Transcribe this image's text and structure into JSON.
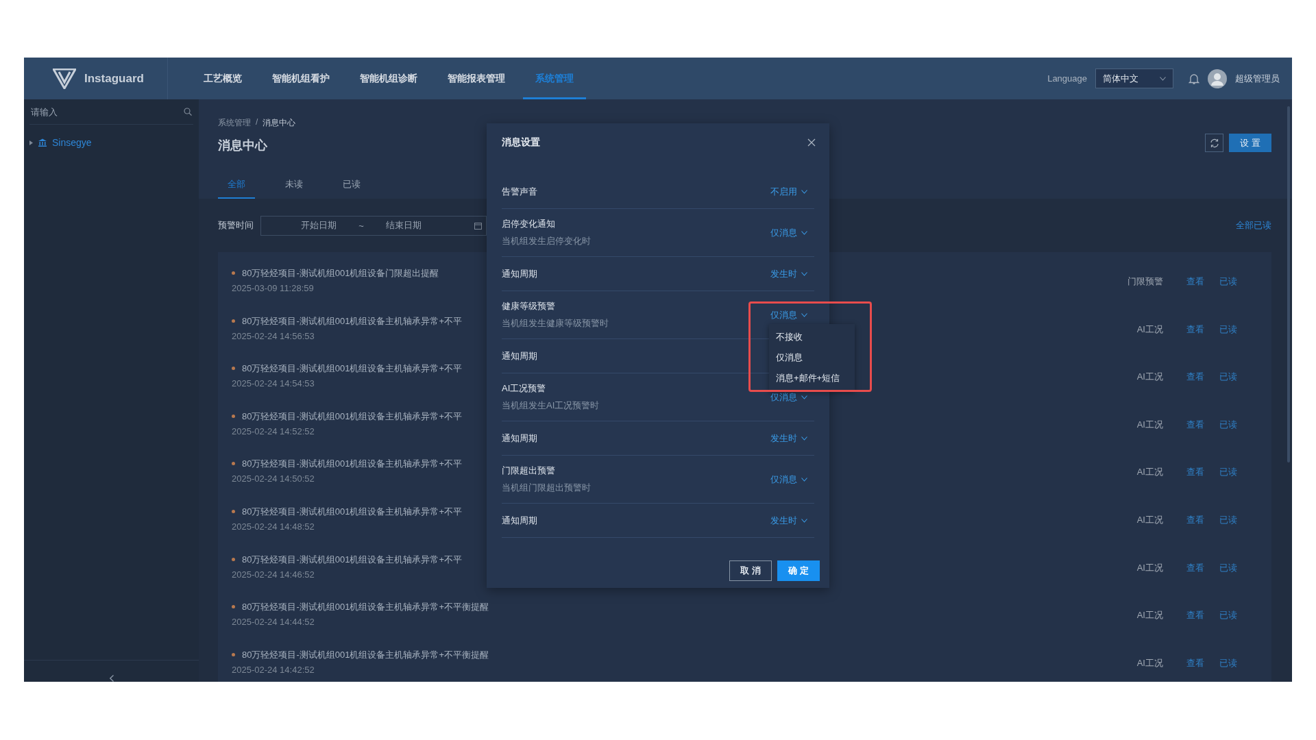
{
  "header": {
    "logo_text": "Instaguard",
    "nav": [
      {
        "label": "工艺概览",
        "selected": false
      },
      {
        "label": "智能机组看护",
        "selected": false
      },
      {
        "label": "智能机组诊断",
        "selected": false
      },
      {
        "label": "智能报表管理",
        "selected": false
      },
      {
        "label": "系统管理",
        "selected": true
      }
    ],
    "language_label": "Language",
    "language_value": "简体中文",
    "user_name": "超级管理员"
  },
  "sidebar": {
    "search_placeholder": "请输入",
    "tree": [
      {
        "label": "Sinsegye",
        "expanded": false
      }
    ]
  },
  "content": {
    "breadcrumb": [
      "系统管理",
      "/",
      "消息中心"
    ],
    "title": "消息中心",
    "refresh": true,
    "settings_button": "设 置",
    "tabs": [
      {
        "label": "全部",
        "selected": true
      },
      {
        "label": "未读",
        "selected": false
      },
      {
        "label": "已读",
        "selected": false
      }
    ],
    "filter": {
      "label": "预警时间",
      "start_placeholder": "开始日期",
      "separator": "~",
      "end_placeholder": "结束日期"
    },
    "mark_all_read": "全部已读",
    "messages": [
      {
        "title": "80万轻烃项目-测试机组001机组设备门限超出提醒",
        "time": "2025-03-09 11:28:59",
        "type": "门限预警",
        "actions": [
          "查看",
          "已读"
        ]
      },
      {
        "title": "80万轻烃项目-测试机组001机组设备主机轴承异常+不平",
        "time": "2025-02-24 14:56:53",
        "type": "AI工况",
        "actions": [
          "查看",
          "已读"
        ]
      },
      {
        "title": "80万轻烃项目-测试机组001机组设备主机轴承异常+不平",
        "time": "2025-02-24 14:54:53",
        "type": "AI工况",
        "actions": [
          "查看",
          "已读"
        ]
      },
      {
        "title": "80万轻烃项目-测试机组001机组设备主机轴承异常+不平",
        "time": "2025-02-24 14:52:52",
        "type": "AI工况",
        "actions": [
          "查看",
          "已读"
        ]
      },
      {
        "title": "80万轻烃项目-测试机组001机组设备主机轴承异常+不平",
        "time": "2025-02-24 14:50:52",
        "type": "AI工况",
        "actions": [
          "查看",
          "已读"
        ]
      },
      {
        "title": "80万轻烃项目-测试机组001机组设备主机轴承异常+不平",
        "time": "2025-02-24 14:48:52",
        "type": "AI工况",
        "actions": [
          "查看",
          "已读"
        ]
      },
      {
        "title": "80万轻烃项目-测试机组001机组设备主机轴承异常+不平",
        "time": "2025-02-24 14:46:52",
        "type": "AI工况",
        "actions": [
          "查看",
          "已读"
        ]
      },
      {
        "title": "80万轻烃项目-测试机组001机组设备主机轴承异常+不平衡提醒",
        "time": "2025-02-24 14:44:52",
        "type": "AI工况",
        "actions": [
          "查看",
          "已读"
        ]
      },
      {
        "title": "80万轻烃项目-测试机组001机组设备主机轴承异常+不平衡提醒",
        "time": "2025-02-24 14:42:52",
        "type": "AI工况",
        "actions": [
          "查看",
          "已读"
        ]
      }
    ]
  },
  "modal": {
    "title": "消息设置",
    "rows": [
      {
        "label": "告警声音",
        "value": "不启用",
        "open": false
      },
      {
        "label": "启停变化通知",
        "description": "当机组发生启停变化时",
        "value": "仅消息",
        "open": false
      },
      {
        "label": "通知周期",
        "value": "发生时",
        "open": false
      },
      {
        "label": "健康等级预警",
        "description": "当机组发生健康等级预警时",
        "value": "仅消息",
        "open": true,
        "options": [
          "不接收",
          "仅消息",
          "消息+邮件+短信"
        ]
      },
      {
        "label": "通知周期"
      },
      {
        "label": "AI工况预警",
        "description": "当机组发生AI工况预警时",
        "value": "仅消息",
        "open": false
      },
      {
        "label": "通知周期",
        "value": "发生时",
        "open": false
      },
      {
        "label": "门限超出预警",
        "description": "当机组门限超出预警时",
        "value": "仅消息",
        "open": false
      },
      {
        "label": "通知周期",
        "value": "发生时",
        "open": false
      }
    ],
    "buttons": [
      {
        "label": "取 消",
        "kind": "secondary"
      },
      {
        "label": "确 定",
        "kind": "primary"
      }
    ]
  }
}
